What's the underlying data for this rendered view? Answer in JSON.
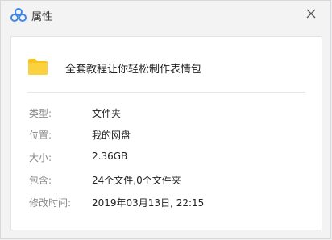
{
  "window": {
    "title": "属性",
    "close_icon": "close-icon",
    "app_icon": "cloud-logo-icon"
  },
  "file": {
    "icon": "folder-icon",
    "name": "全套教程让你轻松制作表情包"
  },
  "properties": [
    {
      "label": "类型:",
      "value": "文件夹"
    },
    {
      "label": "位置:",
      "value": "我的网盘"
    },
    {
      "label": "大小:",
      "value": "2.36GB"
    },
    {
      "label": "包含:",
      "value": "24个文件,0个文件夹"
    },
    {
      "label": "修改时间:",
      "value": "2019年03月13日, 22:15"
    }
  ],
  "colors": {
    "folder": "#f9c51b",
    "logo_blue": "#3b88e8"
  }
}
